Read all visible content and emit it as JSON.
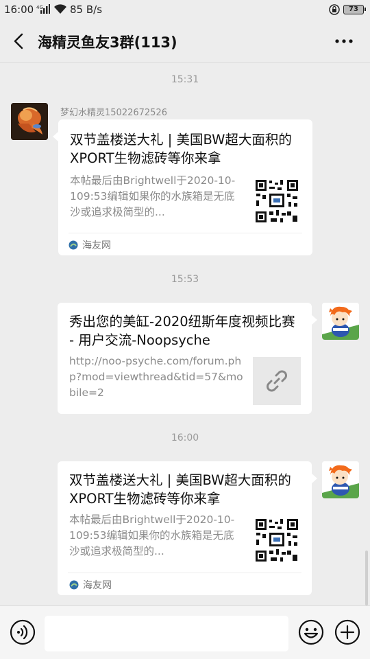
{
  "status_bar": {
    "time": "16:00",
    "signal": "⁴ᴳ",
    "network_speed": "85 B/s",
    "battery": "73"
  },
  "header": {
    "title": "海精灵鱼友3群(113)",
    "back_icon": "chevron-left-icon",
    "more_icon": "more-dots-icon"
  },
  "messages": [
    {
      "timestamp": "15:31",
      "sender": "梦幻水精灵15022672526",
      "side": "left",
      "card": {
        "title": "双节盖楼送大礼 | 美国BW超大面积的XPORT生物滤砖等你来拿",
        "description": "本帖最后由Brightwell于2020-10-109:53编辑如果你的水族箱是无底沙或追求极简型的...",
        "source": "海友网",
        "thumb": "qr-code"
      }
    },
    {
      "timestamp": "15:53",
      "side": "right",
      "card": {
        "title": "秀出您的美缸-2020纽斯年度视频比赛 - 用户交流-Noopsyche",
        "description": "http://noo-psyche.com/forum.php?mod=viewthread&tid=57&mobile=2",
        "thumb": "link-icon"
      }
    },
    {
      "timestamp": "16:00",
      "side": "right",
      "card": {
        "title": "双节盖楼送大礼 | 美国BW超大面积的XPORT生物滤砖等你来拿",
        "description": "本帖最后由Brightwell于2020-10-109:53编辑如果你的水族箱是无底沙或追求极简型的...",
        "source": "海友网",
        "thumb": "qr-code"
      }
    }
  ],
  "input_bar": {
    "text_value": "",
    "voice_icon": "voice-icon",
    "emoji_icon": "emoji-icon",
    "plus_icon": "plus-icon"
  },
  "colors": {
    "background": "#ededed",
    "card": "#ffffff",
    "source_icon": "#1aad19"
  }
}
